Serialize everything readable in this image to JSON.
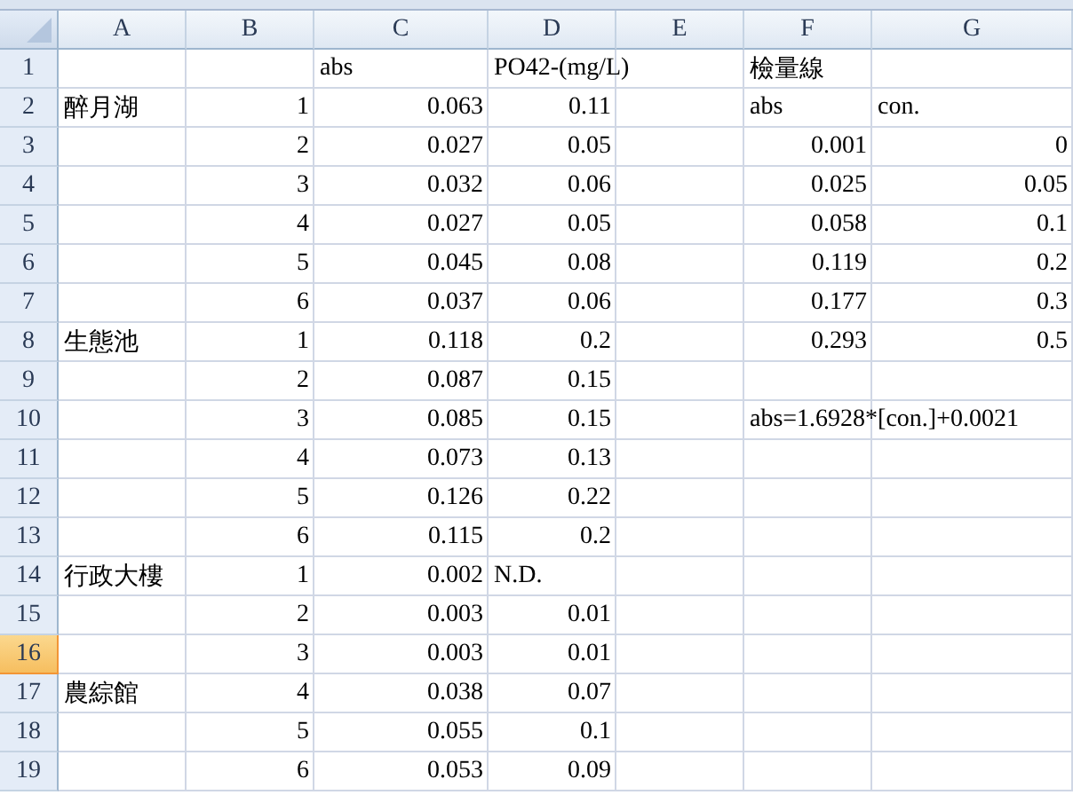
{
  "columns": [
    {
      "label": "A",
      "selected": false
    },
    {
      "label": "B",
      "selected": false
    },
    {
      "label": "C",
      "selected": false
    },
    {
      "label": "D",
      "selected": false
    },
    {
      "label": "E",
      "selected": false
    },
    {
      "label": "F",
      "selected": false
    },
    {
      "label": "G",
      "selected": false
    }
  ],
  "rows": [
    {
      "number": "1",
      "selected": false,
      "cells": [
        null,
        null,
        {
          "text": "abs",
          "kind": "text"
        },
        {
          "text": "PO42-(mg/L)",
          "kind": "text"
        },
        null,
        {
          "text": "檢量線",
          "kind": "text"
        },
        null
      ]
    },
    {
      "number": "2",
      "selected": false,
      "cells": [
        {
          "text": "醉月湖",
          "kind": "text"
        },
        {
          "text": "1",
          "kind": "number"
        },
        {
          "text": "0.063",
          "kind": "number"
        },
        {
          "text": "0.11",
          "kind": "number"
        },
        null,
        {
          "text": "abs",
          "kind": "text"
        },
        {
          "text": "con.",
          "kind": "text"
        }
      ]
    },
    {
      "number": "3",
      "selected": false,
      "cells": [
        null,
        {
          "text": "2",
          "kind": "number"
        },
        {
          "text": "0.027",
          "kind": "number"
        },
        {
          "text": "0.05",
          "kind": "number"
        },
        null,
        {
          "text": "0.001",
          "kind": "number"
        },
        {
          "text": "0",
          "kind": "number"
        }
      ]
    },
    {
      "number": "4",
      "selected": false,
      "cells": [
        null,
        {
          "text": "3",
          "kind": "number"
        },
        {
          "text": "0.032",
          "kind": "number"
        },
        {
          "text": "0.06",
          "kind": "number"
        },
        null,
        {
          "text": "0.025",
          "kind": "number"
        },
        {
          "text": "0.05",
          "kind": "number"
        }
      ]
    },
    {
      "number": "5",
      "selected": false,
      "cells": [
        null,
        {
          "text": "4",
          "kind": "number"
        },
        {
          "text": "0.027",
          "kind": "number"
        },
        {
          "text": "0.05",
          "kind": "number"
        },
        null,
        {
          "text": "0.058",
          "kind": "number"
        },
        {
          "text": "0.1",
          "kind": "number"
        }
      ]
    },
    {
      "number": "6",
      "selected": false,
      "cells": [
        null,
        {
          "text": "5",
          "kind": "number"
        },
        {
          "text": "0.045",
          "kind": "number"
        },
        {
          "text": "0.08",
          "kind": "number"
        },
        null,
        {
          "text": "0.119",
          "kind": "number"
        },
        {
          "text": "0.2",
          "kind": "number"
        }
      ]
    },
    {
      "number": "7",
      "selected": false,
      "cells": [
        null,
        {
          "text": "6",
          "kind": "number"
        },
        {
          "text": "0.037",
          "kind": "number"
        },
        {
          "text": "0.06",
          "kind": "number"
        },
        null,
        {
          "text": "0.177",
          "kind": "number"
        },
        {
          "text": "0.3",
          "kind": "number"
        }
      ]
    },
    {
      "number": "8",
      "selected": false,
      "cells": [
        {
          "text": "生態池",
          "kind": "text"
        },
        {
          "text": "1",
          "kind": "number"
        },
        {
          "text": "0.118",
          "kind": "number"
        },
        {
          "text": "0.2",
          "kind": "number"
        },
        null,
        {
          "text": "0.293",
          "kind": "number"
        },
        {
          "text": "0.5",
          "kind": "number"
        }
      ]
    },
    {
      "number": "9",
      "selected": false,
      "cells": [
        null,
        {
          "text": "2",
          "kind": "number"
        },
        {
          "text": "0.087",
          "kind": "number"
        },
        {
          "text": "0.15",
          "kind": "number"
        },
        null,
        null,
        null
      ]
    },
    {
      "number": "10",
      "selected": false,
      "cells": [
        null,
        {
          "text": "3",
          "kind": "number"
        },
        {
          "text": "0.085",
          "kind": "number"
        },
        {
          "text": "0.15",
          "kind": "number"
        },
        null,
        {
          "text": "abs=1.6928*[con.]+0.0021",
          "kind": "text"
        },
        null
      ]
    },
    {
      "number": "11",
      "selected": false,
      "cells": [
        null,
        {
          "text": "4",
          "kind": "number"
        },
        {
          "text": "0.073",
          "kind": "number"
        },
        {
          "text": "0.13",
          "kind": "number"
        },
        null,
        null,
        null
      ]
    },
    {
      "number": "12",
      "selected": false,
      "cells": [
        null,
        {
          "text": "5",
          "kind": "number"
        },
        {
          "text": "0.126",
          "kind": "number"
        },
        {
          "text": "0.22",
          "kind": "number"
        },
        null,
        null,
        null
      ]
    },
    {
      "number": "13",
      "selected": false,
      "cells": [
        null,
        {
          "text": "6",
          "kind": "number"
        },
        {
          "text": "0.115",
          "kind": "number"
        },
        {
          "text": "0.2",
          "kind": "number"
        },
        null,
        null,
        null
      ]
    },
    {
      "number": "14",
      "selected": false,
      "cells": [
        {
          "text": "行政大樓",
          "kind": "text"
        },
        {
          "text": "1",
          "kind": "number"
        },
        {
          "text": "0.002",
          "kind": "number"
        },
        {
          "text": "N.D.",
          "kind": "text"
        },
        null,
        null,
        null
      ]
    },
    {
      "number": "15",
      "selected": false,
      "cells": [
        null,
        {
          "text": "2",
          "kind": "number"
        },
        {
          "text": "0.003",
          "kind": "number"
        },
        {
          "text": "0.01",
          "kind": "number"
        },
        null,
        null,
        null
      ]
    },
    {
      "number": "16",
      "selected": true,
      "cells": [
        null,
        {
          "text": "3",
          "kind": "number"
        },
        {
          "text": "0.003",
          "kind": "number"
        },
        {
          "text": "0.01",
          "kind": "number"
        },
        null,
        null,
        null
      ]
    },
    {
      "number": "17",
      "selected": false,
      "cells": [
        {
          "text": "農綜館",
          "kind": "text"
        },
        {
          "text": "4",
          "kind": "number"
        },
        {
          "text": "0.038",
          "kind": "number"
        },
        {
          "text": "0.07",
          "kind": "number"
        },
        null,
        null,
        null
      ]
    },
    {
      "number": "18",
      "selected": false,
      "cells": [
        null,
        {
          "text": "5",
          "kind": "number"
        },
        {
          "text": "0.055",
          "kind": "number"
        },
        {
          "text": "0.1",
          "kind": "number"
        },
        null,
        null,
        null
      ]
    },
    {
      "number": "19",
      "selected": false,
      "cells": [
        null,
        {
          "text": "6",
          "kind": "number"
        },
        {
          "text": "0.053",
          "kind": "number"
        },
        {
          "text": "0.09",
          "kind": "number"
        },
        null,
        null,
        null
      ]
    }
  ]
}
